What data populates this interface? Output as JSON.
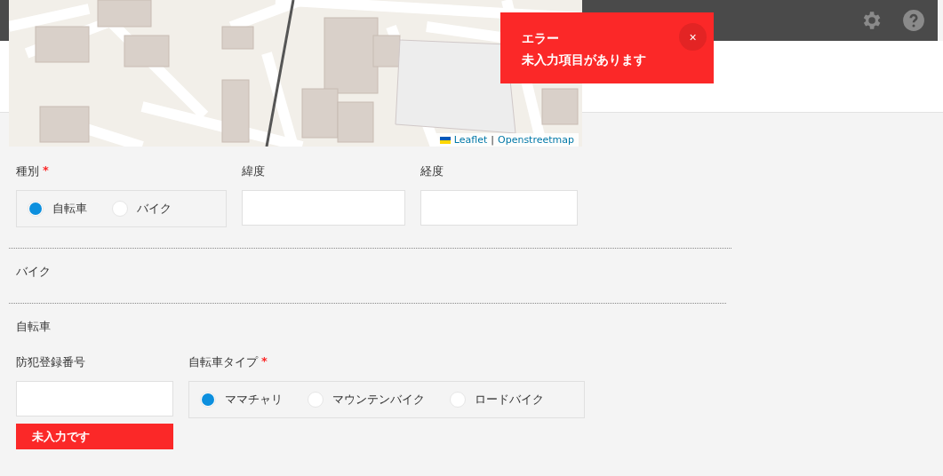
{
  "map": {
    "attribution": {
      "links": [
        "Leaflet",
        "Openstreetmap"
      ],
      "separator": "|"
    }
  },
  "toast": {
    "title": "エラー",
    "message": "未入力項目があります",
    "close": "×"
  },
  "location": {
    "kind_field": {
      "label": "種別",
      "required_mark": "*",
      "options": [
        {
          "label": "自転車",
          "selected": true
        },
        {
          "label": "バイク",
          "selected": false
        }
      ]
    },
    "latitude": {
      "label": "緯度"
    },
    "longitude": {
      "label": "経度"
    }
  },
  "sections": [
    {
      "title": "バイク"
    },
    {
      "title": "自転車",
      "registration": {
        "label": "防犯登録番号",
        "error": "未入力です"
      },
      "bike_type": {
        "label": "自転車タイプ",
        "required_mark": "*",
        "options": [
          {
            "label": "ママチャリ",
            "selected": true
          },
          {
            "label": "マウンテンバイク",
            "selected": false
          },
          {
            "label": "ロードバイク",
            "selected": false
          }
        ]
      }
    }
  ]
}
